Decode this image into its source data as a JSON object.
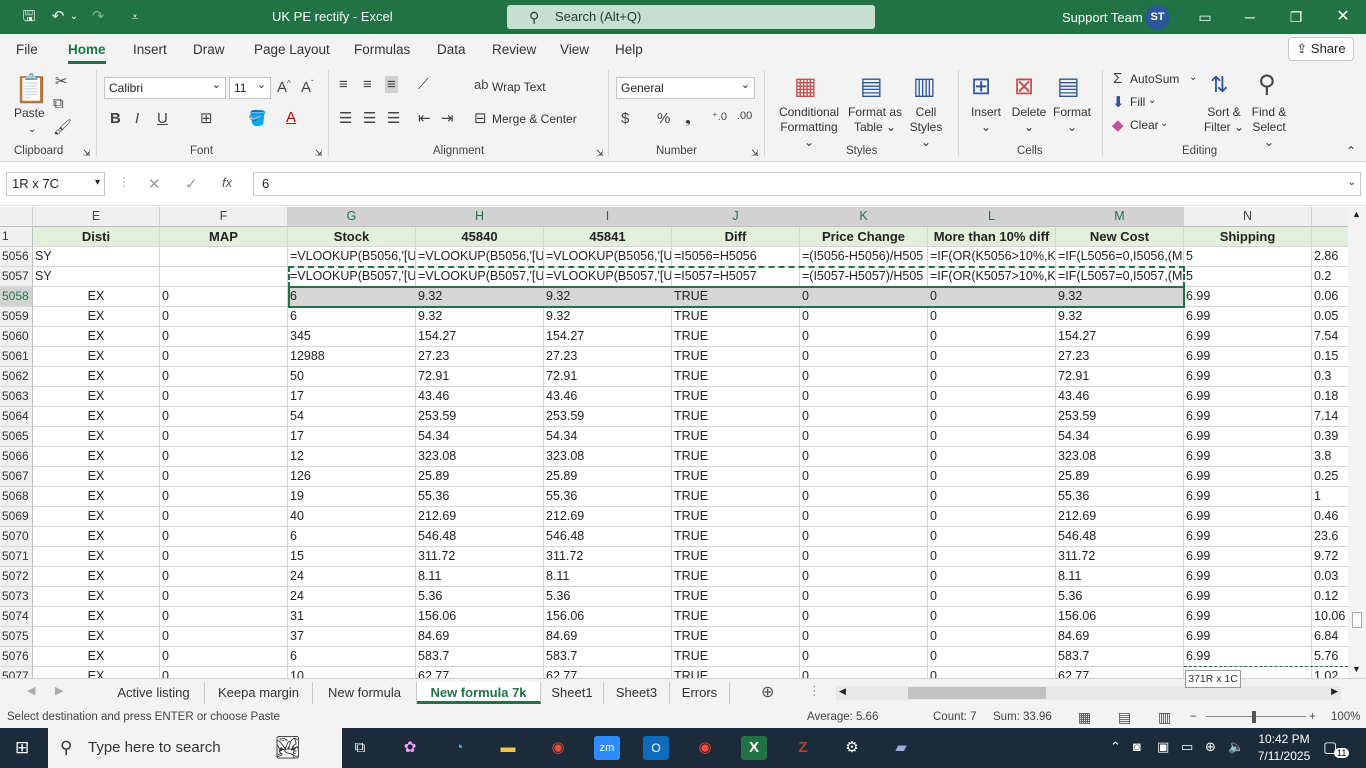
{
  "titlebar": {
    "title": "UK PE rectify  -  Excel",
    "search_placeholder": "Search (Alt+Q)",
    "user": "Support Team",
    "avatar": "ST"
  },
  "menu": {
    "items": [
      "File",
      "Home",
      "Insert",
      "Draw",
      "Page Layout",
      "Formulas",
      "Data",
      "Review",
      "View",
      "Help"
    ],
    "share": "Share"
  },
  "ribbon": {
    "paste": "Paste",
    "font_name": "Calibri",
    "font_size": "11",
    "wrap_text": "Wrap Text",
    "merge_center": "Merge & Center",
    "number_format": "General",
    "conditional_1": "Conditional",
    "conditional_2": "Formatting",
    "format_table_1": "Format as",
    "format_table_2": "Table",
    "cell_styles_1": "Cell",
    "cell_styles_2": "Styles",
    "insert": "Insert",
    "delete": "Delete",
    "format": "Format",
    "autosum": "AutoSum",
    "fill": "Fill",
    "clear": "Clear",
    "sort_filter_1": "Sort &",
    "sort_filter_2": "Filter",
    "find_select_1": "Find &",
    "find_select_2": "Select",
    "groups": {
      "clipboard": "Clipboard",
      "font": "Font",
      "alignment": "Alignment",
      "number": "Number",
      "styles": "Styles",
      "cells": "Cells",
      "editing": "Editing"
    }
  },
  "formula_bar": {
    "name_box": "1R x 7C",
    "fx": "fx",
    "value": "6"
  },
  "columns": [
    "E",
    "F",
    "G",
    "H",
    "I",
    "J",
    "K",
    "L",
    "M",
    "N"
  ],
  "header_row": {
    "row": "1",
    "cells": [
      "Disti",
      "MAP",
      "Stock",
      "45840",
      "45841",
      "Diff",
      "Price Change",
      "More than 10% diff",
      "New Cost",
      "Shipping",
      ""
    ]
  },
  "rows": [
    {
      "r": "5056",
      "c": [
        "SY",
        "",
        "=VLOOKUP(B5056,'[U",
        "=VLOOKUP(B5056,'[U",
        "=VLOOKUP(B5056,'[U",
        "=I5056=H5056",
        "=(I5056-H5056)/H505",
        "=IF(OR(K5056>10%,K",
        "=IF(L5056=0,I5056,(M",
        "5",
        "2.86"
      ]
    },
    {
      "r": "5057",
      "c": [
        "SY",
        "",
        "=VLOOKUP(B5057,'[U",
        "=VLOOKUP(B5057,'[U",
        "=VLOOKUP(B5057,'[U",
        "=I5057=H5057",
        "=(I5057-H5057)/H505",
        "=IF(OR(K5057>10%,K",
        "=IF(L5057=0,I5057,(M",
        "5",
        "0.2"
      ]
    },
    {
      "r": "5058",
      "c": [
        "EX",
        "0",
        "6",
        "9.32",
        "9.32",
        "TRUE",
        "0",
        "0",
        "9.32",
        "6.99",
        "0.06"
      ]
    },
    {
      "r": "5059",
      "c": [
        "EX",
        "0",
        "6",
        "9.32",
        "9.32",
        "TRUE",
        "0",
        "0",
        "9.32",
        "6.99",
        "0.05"
      ]
    },
    {
      "r": "5060",
      "c": [
        "EX",
        "0",
        "345",
        "154.27",
        "154.27",
        "TRUE",
        "0",
        "0",
        "154.27",
        "6.99",
        "7.54"
      ]
    },
    {
      "r": "5061",
      "c": [
        "EX",
        "0",
        "12988",
        "27.23",
        "27.23",
        "TRUE",
        "0",
        "0",
        "27.23",
        "6.99",
        "0.15"
      ]
    },
    {
      "r": "5062",
      "c": [
        "EX",
        "0",
        "50",
        "72.91",
        "72.91",
        "TRUE",
        "0",
        "0",
        "72.91",
        "6.99",
        "0.3"
      ]
    },
    {
      "r": "5063",
      "c": [
        "EX",
        "0",
        "17",
        "43.46",
        "43.46",
        "TRUE",
        "0",
        "0",
        "43.46",
        "6.99",
        "0.18"
      ]
    },
    {
      "r": "5064",
      "c": [
        "EX",
        "0",
        "54",
        "253.59",
        "253.59",
        "TRUE",
        "0",
        "0",
        "253.59",
        "6.99",
        "7.14"
      ]
    },
    {
      "r": "5065",
      "c": [
        "EX",
        "0",
        "17",
        "54.34",
        "54.34",
        "TRUE",
        "0",
        "0",
        "54.34",
        "6.99",
        "0.39"
      ]
    },
    {
      "r": "5066",
      "c": [
        "EX",
        "0",
        "12",
        "323.08",
        "323.08",
        "TRUE",
        "0",
        "0",
        "323.08",
        "6.99",
        "3.8"
      ]
    },
    {
      "r": "5067",
      "c": [
        "EX",
        "0",
        "126",
        "25.89",
        "25.89",
        "TRUE",
        "0",
        "0",
        "25.89",
        "6.99",
        "0.25"
      ]
    },
    {
      "r": "5068",
      "c": [
        "EX",
        "0",
        "19",
        "55.36",
        "55.36",
        "TRUE",
        "0",
        "0",
        "55.36",
        "6.99",
        "1"
      ]
    },
    {
      "r": "5069",
      "c": [
        "EX",
        "0",
        "40",
        "212.69",
        "212.69",
        "TRUE",
        "0",
        "0",
        "212.69",
        "6.99",
        "0.46"
      ]
    },
    {
      "r": "5070",
      "c": [
        "EX",
        "0",
        "6",
        "546.48",
        "546.48",
        "TRUE",
        "0",
        "0",
        "546.48",
        "6.99",
        "23.6"
      ]
    },
    {
      "r": "5071",
      "c": [
        "EX",
        "0",
        "15",
        "311.72",
        "311.72",
        "TRUE",
        "0",
        "0",
        "311.72",
        "6.99",
        "9.72"
      ]
    },
    {
      "r": "5072",
      "c": [
        "EX",
        "0",
        "24",
        "8.11",
        "8.11",
        "TRUE",
        "0",
        "0",
        "8.11",
        "6.99",
        "0.03"
      ]
    },
    {
      "r": "5073",
      "c": [
        "EX",
        "0",
        "24",
        "5.36",
        "5.36",
        "TRUE",
        "0",
        "0",
        "5.36",
        "6.99",
        "0.12"
      ]
    },
    {
      "r": "5074",
      "c": [
        "EX",
        "0",
        "31",
        "156.06",
        "156.06",
        "TRUE",
        "0",
        "0",
        "156.06",
        "6.99",
        "10.06"
      ]
    },
    {
      "r": "5075",
      "c": [
        "EX",
        "0",
        "37",
        "84.69",
        "84.69",
        "TRUE",
        "0",
        "0",
        "84.69",
        "6.99",
        "6.84"
      ]
    },
    {
      "r": "5076",
      "c": [
        "EX",
        "0",
        "6",
        "583.7",
        "583.7",
        "TRUE",
        "0",
        "0",
        "583.7",
        "6.99",
        "5.76"
      ]
    },
    {
      "r": "5077",
      "c": [
        "EX",
        "0",
        "10",
        "62.77",
        "62.77",
        "TRUE",
        "0",
        "0",
        "62.77",
        "6.99",
        "1.02"
      ]
    }
  ],
  "sheets": [
    "Active listing",
    "Keepa margin",
    "New formula",
    "New formula 7k",
    "Sheet1",
    "Sheet3",
    "Errors"
  ],
  "active_sheet": "New formula 7k",
  "tooltip": "371R x 1C",
  "status": {
    "message": "Select destination and press ENTER or choose Paste",
    "average": "Average: 5.66",
    "count": "Count: 7",
    "sum": "Sum: 33.96",
    "zoom": "100%"
  },
  "taskbar": {
    "search_placeholder": "Type here to search",
    "time": "10:42 PM",
    "date": "7/11/2025",
    "notifications": "11"
  }
}
